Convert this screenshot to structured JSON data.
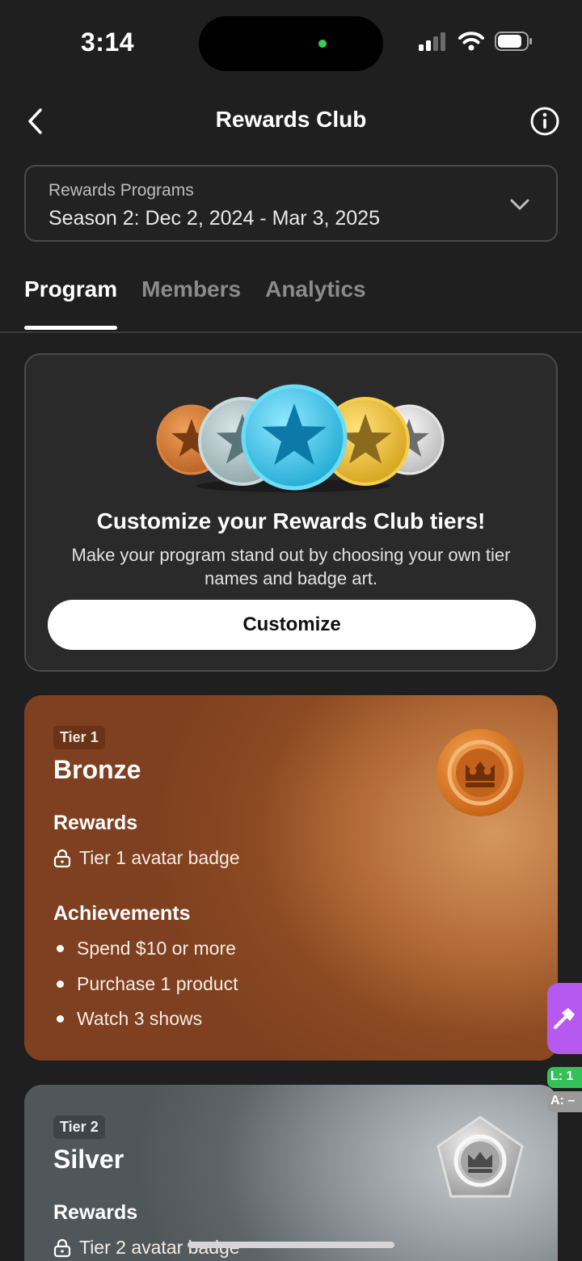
{
  "status_bar": {
    "time": "3:14",
    "battery_level": 0.85
  },
  "header": {
    "title": "Rewards Club"
  },
  "program_selector": {
    "label": "Rewards Programs",
    "value": "Season 2: Dec 2, 2024 - Mar 3, 2025"
  },
  "tabs": [
    {
      "label": "Program",
      "active": true
    },
    {
      "label": "Members",
      "active": false
    },
    {
      "label": "Analytics",
      "active": false
    }
  ],
  "promo": {
    "title": "Customize your Rewards Club tiers!",
    "description": "Make your program stand out by choosing your own tier names and badge art.",
    "button_label": "Customize"
  },
  "tiers": [
    {
      "chip": "Tier 1",
      "name": "Bronze",
      "rewards_heading": "Rewards",
      "rewards": [
        "Tier 1 avatar badge"
      ],
      "achievements_heading": "Achievements",
      "achievements": [
        "Spend $10 or more",
        "Purchase 1 product",
        "Watch 3 shows"
      ]
    },
    {
      "chip": "Tier 2",
      "name": "Silver",
      "rewards_heading": "Rewards",
      "rewards": [
        "Tier 2 avatar badge"
      ]
    }
  ],
  "dev_overlay": {
    "pill_green": "L: 1",
    "pill_gray": "A: –"
  },
  "colors": {
    "background": "#1f1f1f",
    "bronze": "#8c4a22",
    "silver": "#5e6569",
    "accent_purple": "#b659f0"
  }
}
